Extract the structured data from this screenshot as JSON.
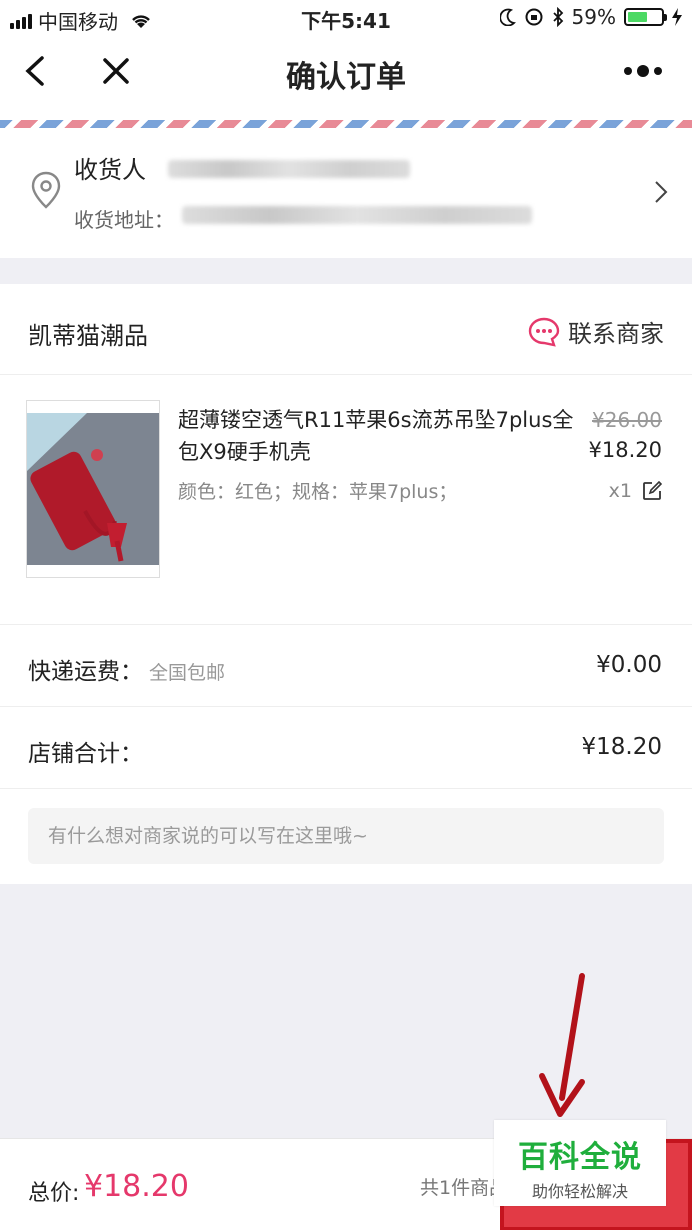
{
  "status_bar": {
    "carrier": "中国移动",
    "time": "下午5:41",
    "battery_percent": "59%",
    "battery_level": 0.59
  },
  "nav": {
    "title": "确认订单",
    "back_icon": "chevron-left-icon",
    "close_icon": "close-icon",
    "more_icon": "more-icon"
  },
  "address": {
    "receiver_label": "收货人",
    "address_label": "收货地址："
  },
  "shop": {
    "name": "凯蒂猫潮品",
    "contact_label": "联系商家",
    "accent_color": "#e5386b"
  },
  "product": {
    "title": "超薄镂空透气R11苹果6s流苏吊坠7plus全包X9硬手机壳",
    "spec": "颜色：红色；规格：苹果7plus；",
    "original_price": "¥26.00",
    "price": "¥18.20",
    "quantity": "x1"
  },
  "shipping": {
    "label": "快递运费：",
    "note": "全国包邮",
    "value": "¥0.00"
  },
  "shop_total": {
    "label": "店铺合计：",
    "value": "¥18.20"
  },
  "memo": {
    "placeholder": "有什么想对商家说的可以写在这里哦~"
  },
  "bottom": {
    "total_label": "总价:",
    "total_price": "¥18.20",
    "count_text": "共1件商品"
  },
  "watermark": {
    "main": "百科全说",
    "sub": "助你轻松解决"
  }
}
